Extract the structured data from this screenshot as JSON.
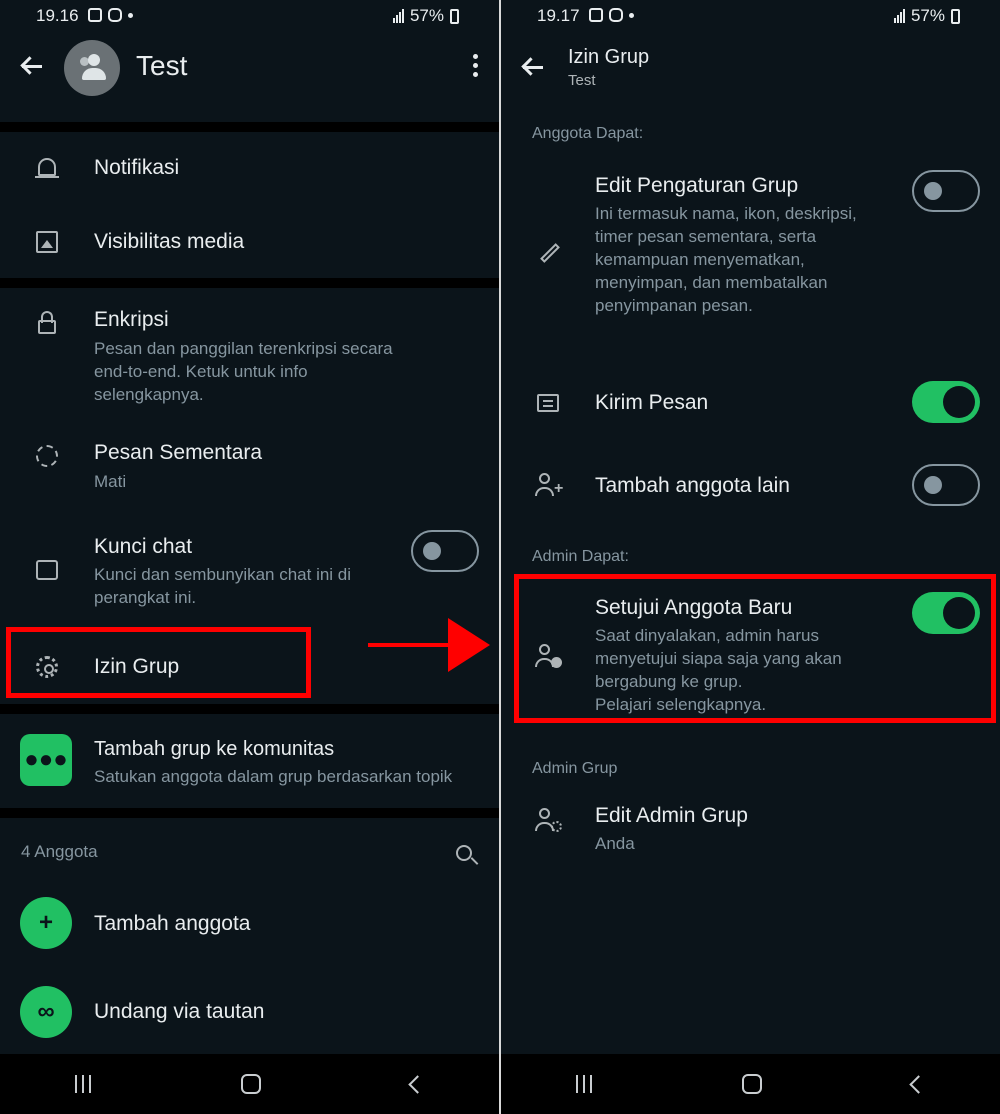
{
  "left": {
    "status": {
      "time": "19.16",
      "battery": "57%"
    },
    "header": {
      "title": "Test"
    },
    "rows": {
      "notifikasi": "Notifikasi",
      "visibilitas": "Visibilitas media",
      "enkripsi_title": "Enkripsi",
      "enkripsi_sub": "Pesan dan panggilan terenkripsi secara end-to-end. Ketuk untuk info selengkapnya.",
      "pesan_title": "Pesan Sementara",
      "pesan_sub": "Mati",
      "kunci_title": "Kunci chat",
      "kunci_sub": "Kunci dan sembunyikan chat ini di perangkat ini.",
      "izin": "Izin Grup",
      "komunitas_title": "Tambah grup ke komunitas",
      "komunitas_sub": "Satukan anggota dalam grup berdasarkan topik"
    },
    "members": {
      "count_label": "4 Anggota",
      "add": "Tambah anggota",
      "invite": "Undang via tautan"
    },
    "toggles": {
      "kunci_chat": false
    }
  },
  "right": {
    "status": {
      "time": "19.17",
      "battery": "57%"
    },
    "header": {
      "title": "Izin Grup",
      "subtitle": "Test"
    },
    "section_members": "Anggota Dapat:",
    "edit_title": "Edit Pengaturan Grup",
    "edit_sub": "Ini termasuk nama, ikon, deskripsi, timer pesan sementara, serta kemampuan menyematkan, menyimpan, dan membatalkan penyimpanan pesan.",
    "kirim": "Kirim Pesan",
    "tambah": "Tambah anggota lain",
    "section_admin": "Admin Dapat:",
    "setujui_title": "Setujui Anggota Baru",
    "setujui_sub": "Saat dinyalakan, admin harus menyetujui siapa saja yang akan bergabung ke grup.",
    "setujui_link": "Pelajari selengkapnya.",
    "section_admin_grup": "Admin Grup",
    "edit_admin_title": "Edit Admin Grup",
    "edit_admin_sub": "Anda",
    "toggles": {
      "edit_pengaturan": false,
      "kirim_pesan": true,
      "tambah_anggota": false,
      "setujui_anggota": true
    }
  },
  "colors": {
    "accent": "#21c063",
    "highlight": "#ff0000",
    "link": "#53bdeb",
    "background": "#0b141a"
  }
}
